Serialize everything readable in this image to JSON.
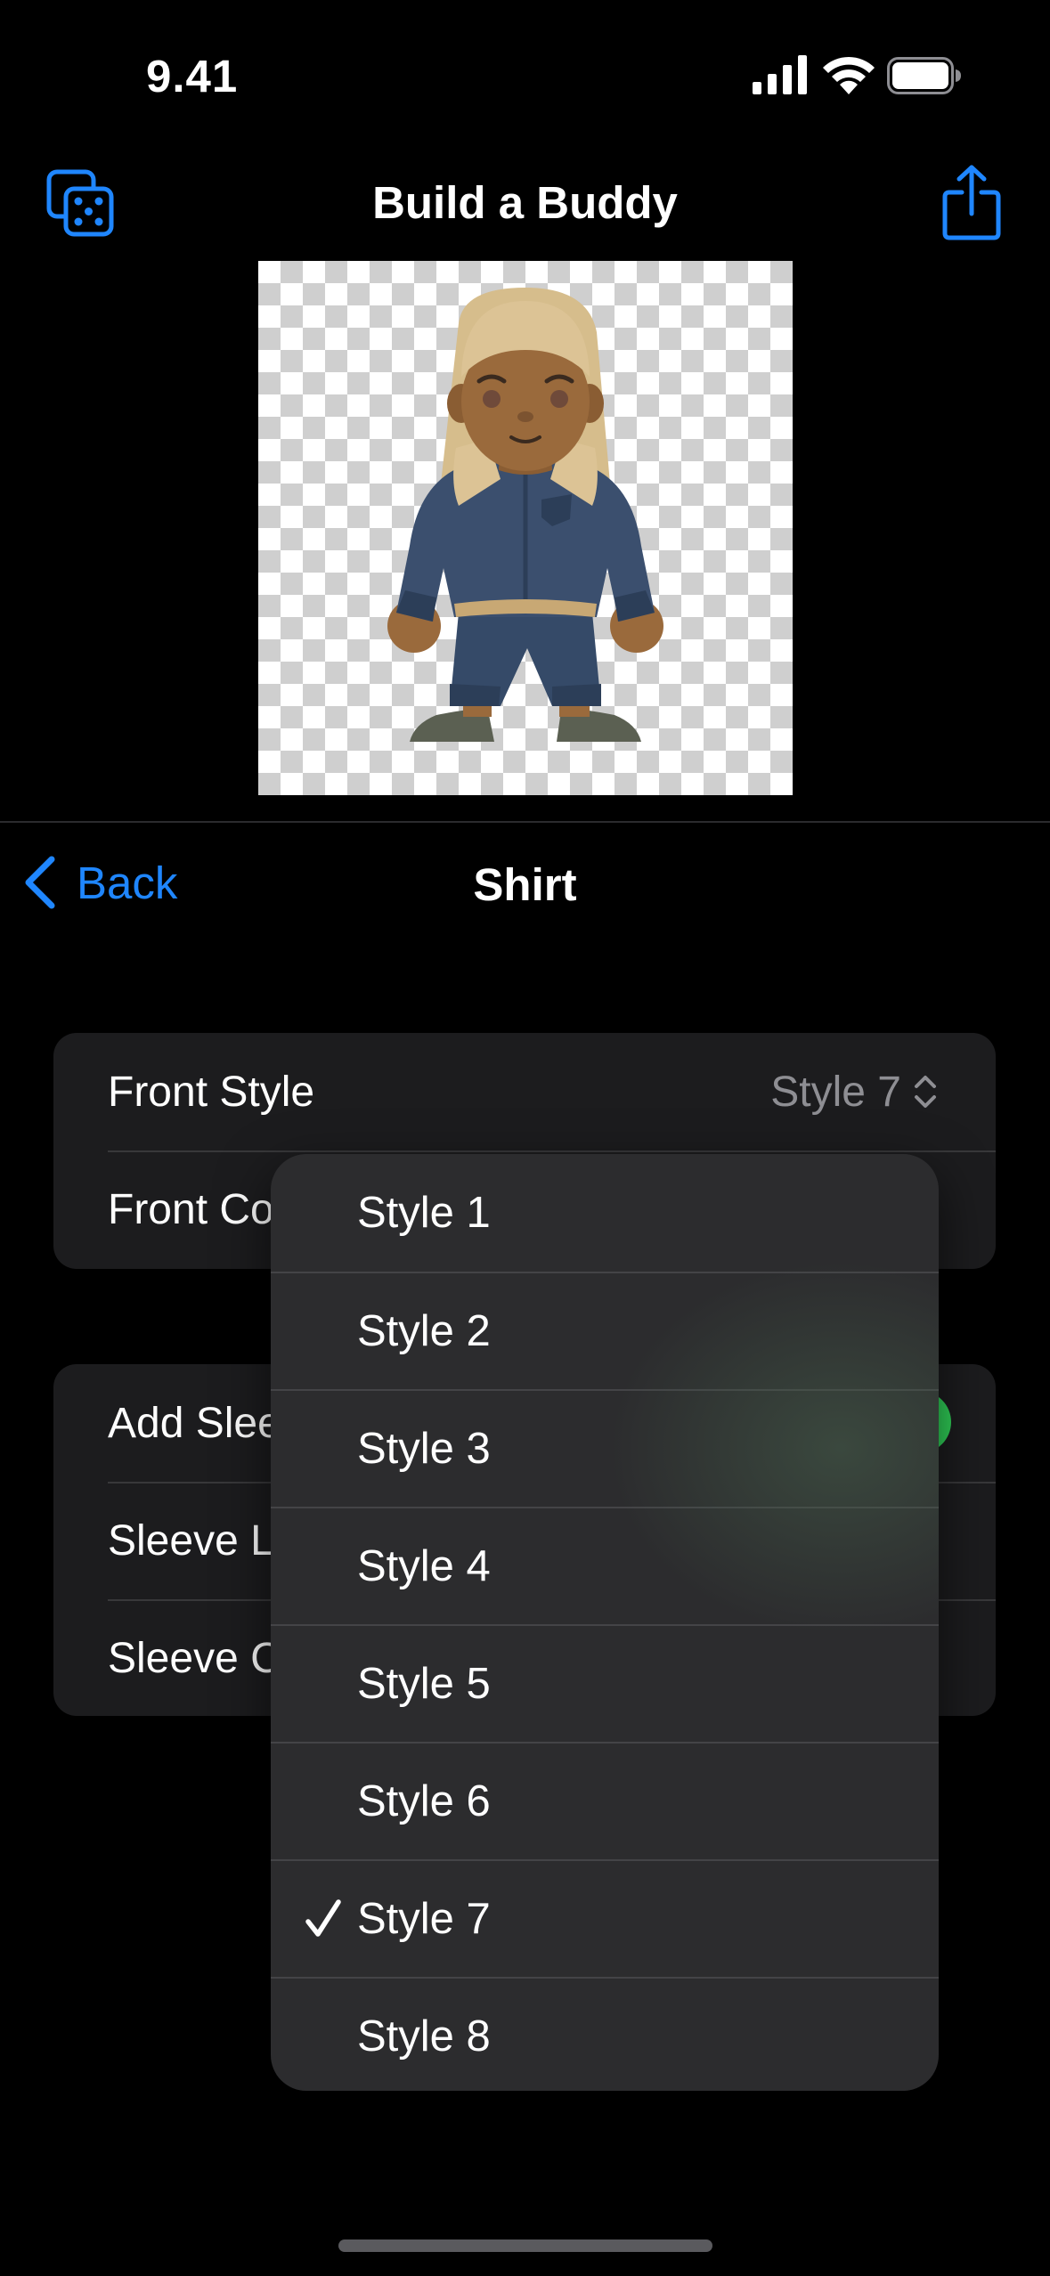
{
  "status_bar": {
    "time": "9.41"
  },
  "top_nav": {
    "title": "Build a Buddy",
    "randomize_icon": "dice-icon",
    "share_icon": "share-icon"
  },
  "sub_nav": {
    "back_label": "Back",
    "title": "Shirt"
  },
  "settings": {
    "front_style": {
      "label": "Front Style",
      "value": "Style 7"
    },
    "front_color": {
      "label": "Front Co"
    },
    "add_sleeves": {
      "label": "Add Slee",
      "enabled": true
    },
    "sleeve_length": {
      "label": "Sleeve L"
    },
    "sleeve_color": {
      "label": "Sleeve C"
    }
  },
  "dropdown": {
    "options": [
      "Style 1",
      "Style 2",
      "Style 3",
      "Style 4",
      "Style 5",
      "Style 6",
      "Style 7",
      "Style 8"
    ],
    "selected": "Style 7"
  },
  "colors": {
    "accent": "#1f86ff",
    "toggle_on": "#30d158",
    "jacket": "#3b4f6e",
    "skin": "#9a6a3c",
    "hair": "#dcc395"
  }
}
